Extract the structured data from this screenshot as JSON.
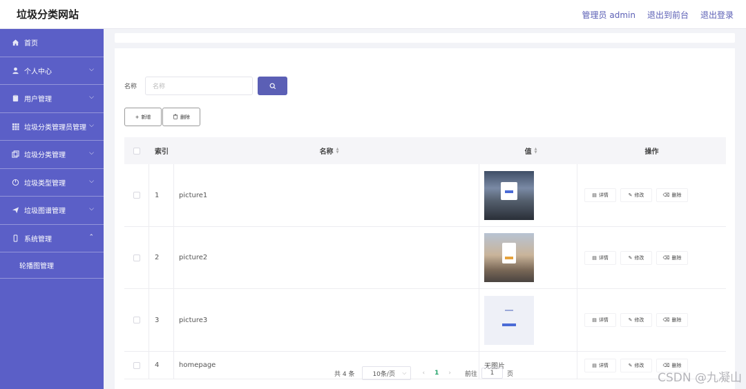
{
  "header": {
    "title": "垃圾分类网站",
    "admin_label": "管理员 admin",
    "back_front": "退出到前台",
    "logout": "退出登录"
  },
  "sidebar": {
    "items": [
      {
        "label": "首页",
        "icon": "home-icon"
      },
      {
        "label": "个人中心",
        "icon": "user-icon"
      },
      {
        "label": "用户管理",
        "icon": "clipboard-icon"
      },
      {
        "label": "垃圾分类管理员管理",
        "icon": "grid-icon"
      },
      {
        "label": "垃圾分类管理",
        "icon": "copy-icon"
      },
      {
        "label": "垃圾类型管理",
        "icon": "circle-icon"
      },
      {
        "label": "垃圾图谱管理",
        "icon": "send-icon"
      },
      {
        "label": "系统管理",
        "icon": "phone-icon"
      }
    ],
    "submenu": {
      "label": "轮播图管理"
    }
  },
  "search": {
    "label": "名称",
    "placeholder": "名称"
  },
  "toolbar": {
    "add": "新增",
    "delete": "删除"
  },
  "table": {
    "headers": {
      "index": "索引",
      "name": "名称",
      "value": "值",
      "ops": "操作"
    },
    "rows": [
      {
        "index": "1",
        "name": "picture1",
        "value": ""
      },
      {
        "index": "2",
        "name": "picture2",
        "value": ""
      },
      {
        "index": "3",
        "name": "picture3",
        "value": ""
      },
      {
        "index": "4",
        "name": "homepage",
        "value": "无图片"
      }
    ],
    "ops": {
      "detail": "详情",
      "edit": "修改",
      "delete": "删除"
    }
  },
  "pagination": {
    "total": "共 4 条",
    "page_size": "10条/页",
    "current": "1",
    "goto_label": "前往",
    "goto_value": "1",
    "page_unit": "页"
  },
  "watermark": "CSDN @九凝山",
  "colors": {
    "accent": "#5b5fc7",
    "link": "#5b5fb5"
  }
}
